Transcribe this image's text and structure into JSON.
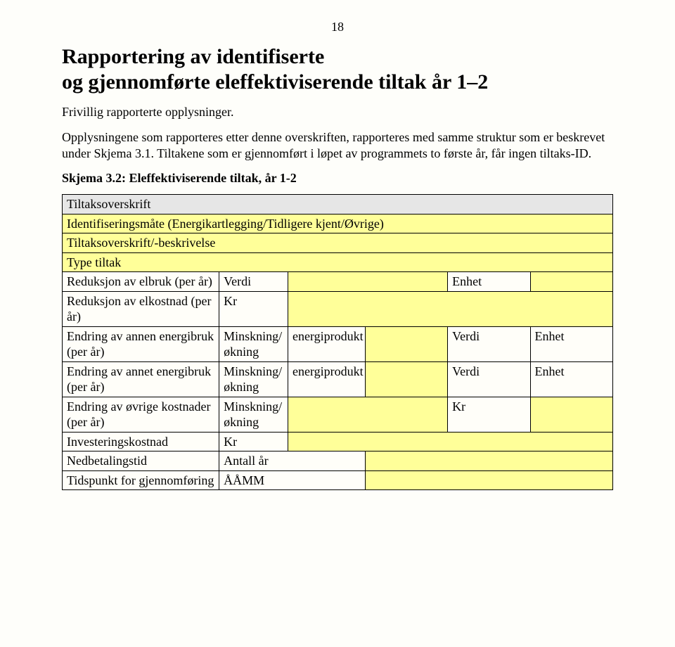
{
  "page_number": "18",
  "heading_line1": "Rapportering av identifiserte",
  "heading_line2": "og gjennomførte eleffektiviserende tiltak år 1–2",
  "subtitle": "Frivillig rapporterte opplysninger.",
  "para1": "Opplysningene som rapporteres etter denne overskriften, rapporteres med samme struktur som er beskrevet under Skjema 3.1. Tiltakene som er gjennomført i løpet av programmets to første år, får ingen tiltaks-ID.",
  "skjema_title": "Skjema 3.2: Eleffektiviserende tiltak, år 1-2",
  "rows": {
    "tiltaksoverskrift": "Tiltaksoverskrift",
    "identifisering": "Identifiseringsmåte (Energikartlegging/Tidligere kjent/Øvrige)",
    "tiltaksbesk": "Tiltaksoverskrift/-beskrivelse",
    "type_tiltak": "Type tiltak",
    "reduksjon_elbruk": "Reduksjon av elbruk (per år)",
    "reduksjon_elkost": "Reduksjon av elkostnad (per år)",
    "endring_annen": "Endring av annen energibruk            (per år)",
    "endring_annet": "Endring av annet energibruk            (per år)",
    "endring_ovrige": "Endring av øvrige kostnader (per år)",
    "investering": "Investeringskostnad",
    "nedbetaling": "Nedbetalingstid",
    "tidspunkt": "Tidspunkt for gjennomføring"
  },
  "labels": {
    "verdi": "Verdi",
    "enhet": "Enhet",
    "kr": "Kr",
    "minskning": "Minskning/ økning",
    "energiprodukt": "energiprodukt",
    "antall_ar": "Antall år",
    "aamm": "ÅÅMM"
  }
}
